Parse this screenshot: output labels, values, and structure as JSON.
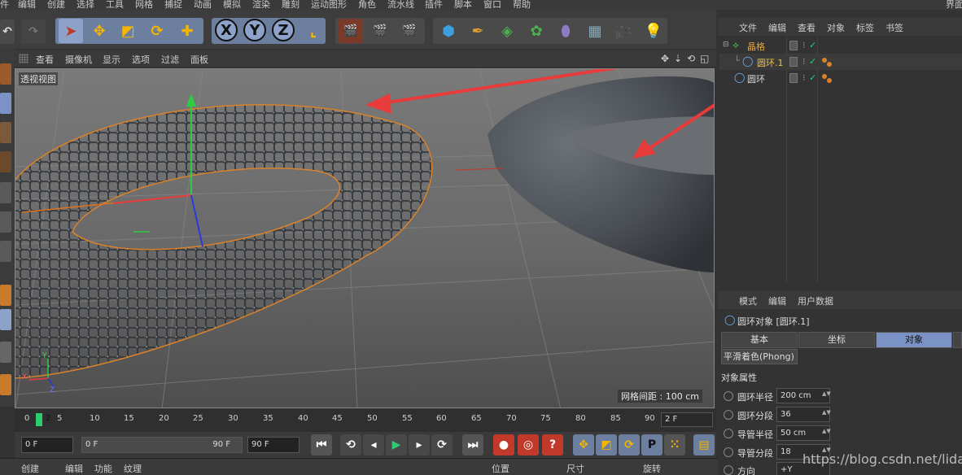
{
  "menu": [
    "件",
    "编辑",
    "创建",
    "选择",
    "工具",
    "网格",
    "捕捉",
    "动画",
    "模拟",
    "渲染",
    "雕刻",
    "运动图形",
    "角色",
    "流水线",
    "插件",
    "脚本",
    "窗口",
    "帮助"
  ],
  "menu_right": "界面",
  "toolbar": {
    "axis_buttons": [
      "X",
      "Y",
      "Z"
    ]
  },
  "viewport": {
    "menu": [
      "查看",
      "摄像机",
      "显示",
      "选项",
      "过滤",
      "面板"
    ],
    "label": "透视视图",
    "grid_spacing": "网格间距 : 100 cm",
    "axis_labels": [
      "Y",
      "X",
      "Z"
    ]
  },
  "timeline": {
    "ticks": [
      "0",
      "2",
      "5",
      "10",
      "15",
      "20",
      "25",
      "30",
      "35",
      "40",
      "45",
      "50",
      "55",
      "60",
      "65",
      "70",
      "75",
      "80",
      "85",
      "90"
    ],
    "current_frame": "2",
    "frame_field": "2 F"
  },
  "transport": {
    "start": "0 F",
    "range_start": "0 F",
    "range_end": "90 F",
    "end": "90 F"
  },
  "bottom": {
    "left_tabs": [
      "创建",
      "编辑",
      "功能",
      "纹理"
    ],
    "coords": [
      "位置",
      "尺寸",
      "旋转"
    ]
  },
  "object_manager": {
    "menu": [
      "文件",
      "编辑",
      "查看",
      "对象",
      "标签",
      "书签"
    ],
    "objects": [
      {
        "name": "晶格",
        "color": "#e8a53a"
      },
      {
        "name": "圆环.1",
        "color": "#f0c040"
      },
      {
        "name": "圆环",
        "color": "#d8d8d8"
      }
    ]
  },
  "attributes": {
    "menu": [
      "模式",
      "编辑",
      "用户数据"
    ],
    "title": "圆环对象 [圆环.1]",
    "tabs": [
      "基本",
      "坐标",
      "对象"
    ],
    "active_tab": "对象",
    "phong": "平滑着色(Phong)",
    "section": "对象属性",
    "props": [
      {
        "label": "圆环半径",
        "value": "200 cm"
      },
      {
        "label": "圆环分段",
        "value": "36"
      },
      {
        "label": "导管半径",
        "value": "50 cm"
      },
      {
        "label": "导管分段",
        "value": "18"
      },
      {
        "label": "方向",
        "value": "+Y"
      }
    ]
  },
  "watermark": "https://blog.csdn.net/lidashent",
  "colors": {
    "accent": "#6d7f9e",
    "tab_active": "#7a92c4",
    "arrow": "#e83b3b",
    "selection_orange": "#d9822b"
  }
}
